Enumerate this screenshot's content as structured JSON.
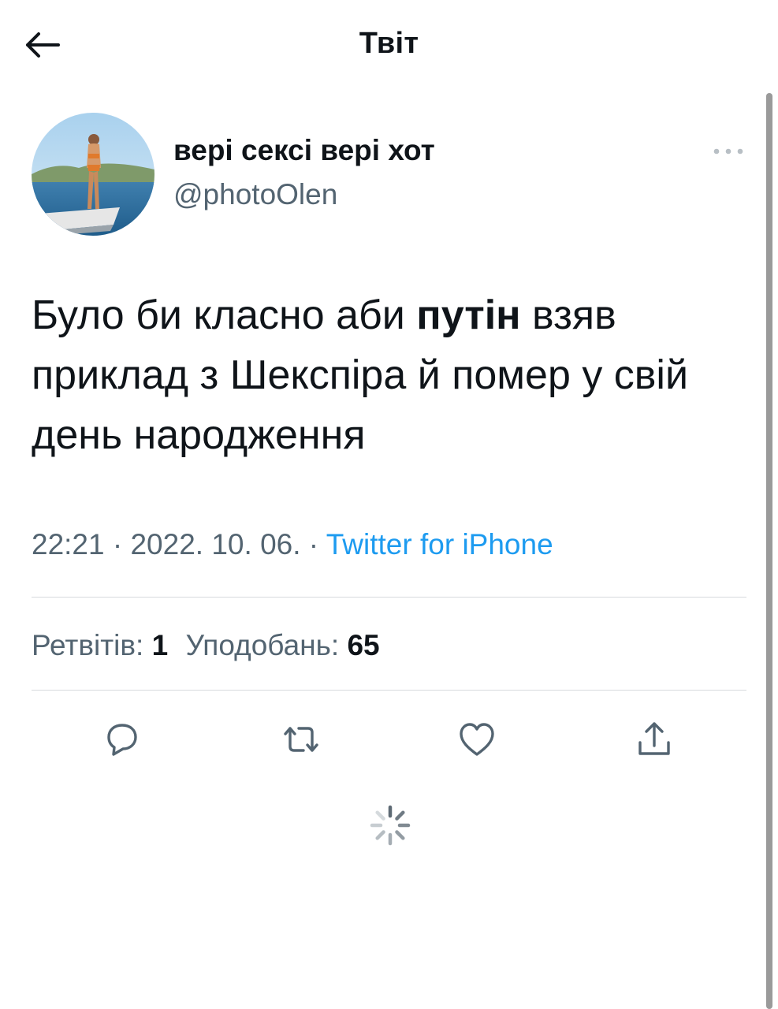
{
  "header": {
    "title": "Твіт",
    "back_icon": "arrow-left-icon"
  },
  "tweet": {
    "display_name": "вері сексі вері хот",
    "handle": "@photoOlen",
    "more_icon": "more-horizontal-icon",
    "text_before": "Було би класно аби ",
    "text_bold": "путін",
    "text_after": " взяв приклад з Шекспіра й помер у свій день народження",
    "time": "22:21",
    "separator": "·",
    "date": "2022. 10. 06.",
    "source": "Twitter for iPhone"
  },
  "stats": {
    "retweets_label": "Ретвітів:",
    "retweets_count": "1",
    "likes_label": "Уподобань:",
    "likes_count": "65"
  },
  "actions": {
    "reply_icon": "reply-icon",
    "retweet_icon": "retweet-icon",
    "like_icon": "heart-icon",
    "share_icon": "share-icon"
  },
  "colors": {
    "link": "#1d9bf0",
    "secondary_text": "#536471",
    "primary_text": "#0f1419"
  }
}
